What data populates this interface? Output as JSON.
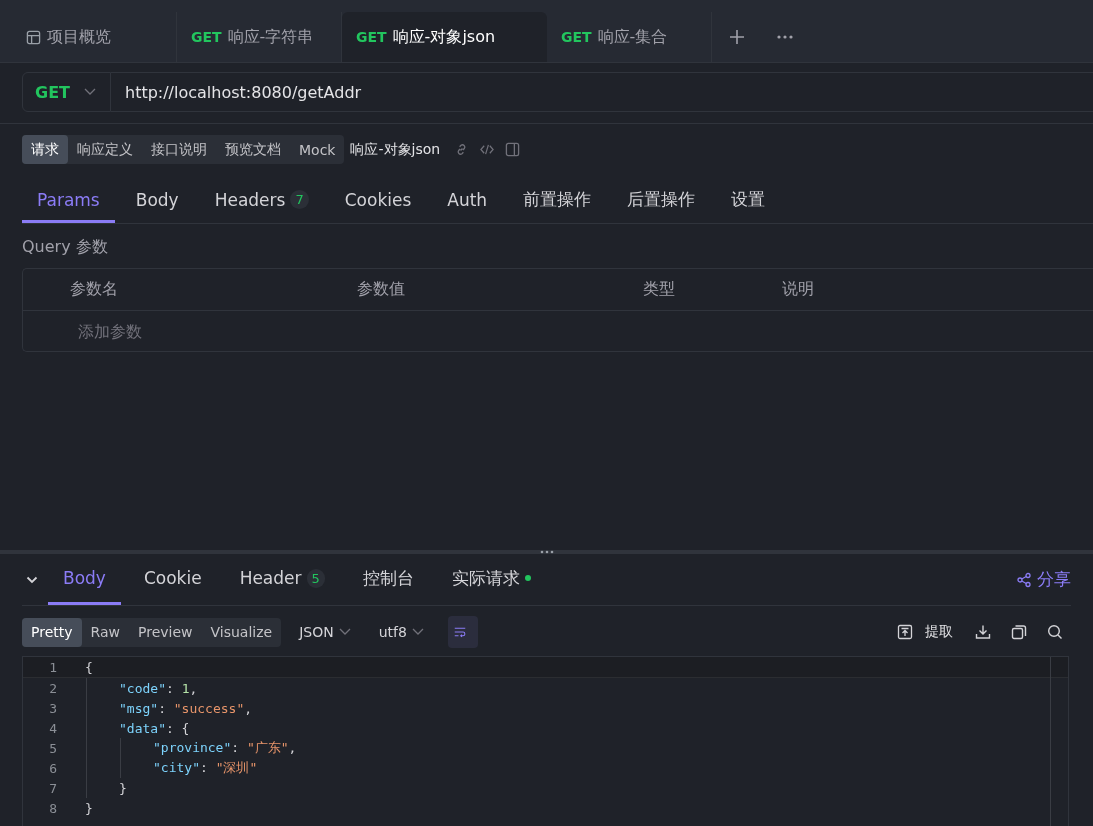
{
  "tabs": [
    {
      "kind": "overview",
      "label": "项目概览",
      "selected": false
    },
    {
      "kind": "request",
      "method": "GET",
      "label": "响应-字符串",
      "selected": false
    },
    {
      "kind": "request",
      "method": "GET",
      "label": "响应-对象json",
      "selected": true
    },
    {
      "kind": "request",
      "method": "GET",
      "label": "响应-集合",
      "selected": false
    }
  ],
  "request": {
    "method": "GET",
    "url": "http://localhost:8080/getAddr"
  },
  "doc_tabs": [
    {
      "label": "请求",
      "selected": true
    },
    {
      "label": "响应定义",
      "selected": false
    },
    {
      "label": "接口说明",
      "selected": false
    },
    {
      "label": "预览文档",
      "selected": false
    },
    {
      "label": "Mock",
      "selected": false
    }
  ],
  "doc_title": "响应-对象json",
  "param_tabs": [
    {
      "label": "Params",
      "selected": true
    },
    {
      "label": "Body",
      "selected": false
    },
    {
      "label": "Headers",
      "badge": "7",
      "selected": false
    },
    {
      "label": "Cookies",
      "selected": false
    },
    {
      "label": "Auth",
      "selected": false
    },
    {
      "label": "前置操作",
      "selected": false
    },
    {
      "label": "后置操作",
      "selected": false
    },
    {
      "label": "设置",
      "selected": false
    }
  ],
  "query": {
    "label": "Query 参数",
    "columns": [
      "参数名",
      "参数值",
      "类型",
      "说明"
    ],
    "placeholder": "添加参数"
  },
  "response": {
    "tabs": [
      {
        "label": "Body",
        "selected": true
      },
      {
        "label": "Cookie",
        "selected": false
      },
      {
        "label": "Header",
        "badge": "5",
        "selected": false
      },
      {
        "label": "控制台",
        "selected": false
      },
      {
        "label": "实际请求",
        "dot": true,
        "selected": false
      }
    ],
    "share": "分享",
    "view_modes": [
      {
        "label": "Pretty",
        "selected": true
      },
      {
        "label": "Raw",
        "selected": false
      },
      {
        "label": "Preview",
        "selected": false
      },
      {
        "label": "Visualize",
        "selected": false
      }
    ],
    "format": "JSON",
    "encoding": "utf8",
    "word_wrap": true,
    "extract": "提取",
    "code": [
      {
        "number": "1",
        "tokens": [
          {
            "kind": "punct",
            "text": "{"
          }
        ],
        "children": [
          {
            "number": "2",
            "tokens": [
              {
                "kind": "key",
                "text": "\"code\""
              },
              {
                "kind": "punct",
                "text": ": "
              },
              {
                "kind": "number",
                "text": "1"
              },
              {
                "kind": "punct",
                "text": ","
              }
            ]
          },
          {
            "number": "3",
            "tokens": [
              {
                "kind": "key",
                "text": "\"msg\""
              },
              {
                "kind": "punct",
                "text": ": "
              },
              {
                "kind": "string",
                "text": "\"success\""
              },
              {
                "kind": "punct",
                "text": ","
              }
            ]
          },
          {
            "number": "4",
            "tokens": [
              {
                "kind": "key",
                "text": "\"data\""
              },
              {
                "kind": "punct",
                "text": ": {"
              }
            ],
            "children": [
              {
                "number": "5",
                "tokens": [
                  {
                    "kind": "key",
                    "text": "\"province\""
                  },
                  {
                    "kind": "punct",
                    "text": ": "
                  },
                  {
                    "kind": "string",
                    "text": "\"广东\""
                  },
                  {
                    "kind": "punct",
                    "text": ","
                  }
                ]
              },
              {
                "number": "6",
                "tokens": [
                  {
                    "kind": "key",
                    "text": "\"city\""
                  },
                  {
                    "kind": "punct",
                    "text": ": "
                  },
                  {
                    "kind": "string",
                    "text": "\"深圳\""
                  }
                ]
              }
            ]
          },
          {
            "number": "7",
            "tokens": [
              {
                "kind": "punct",
                "text": "}"
              }
            ]
          }
        ]
      },
      {
        "number": "8",
        "tokens": [
          {
            "kind": "punct",
            "text": "}"
          }
        ]
      }
    ]
  }
}
